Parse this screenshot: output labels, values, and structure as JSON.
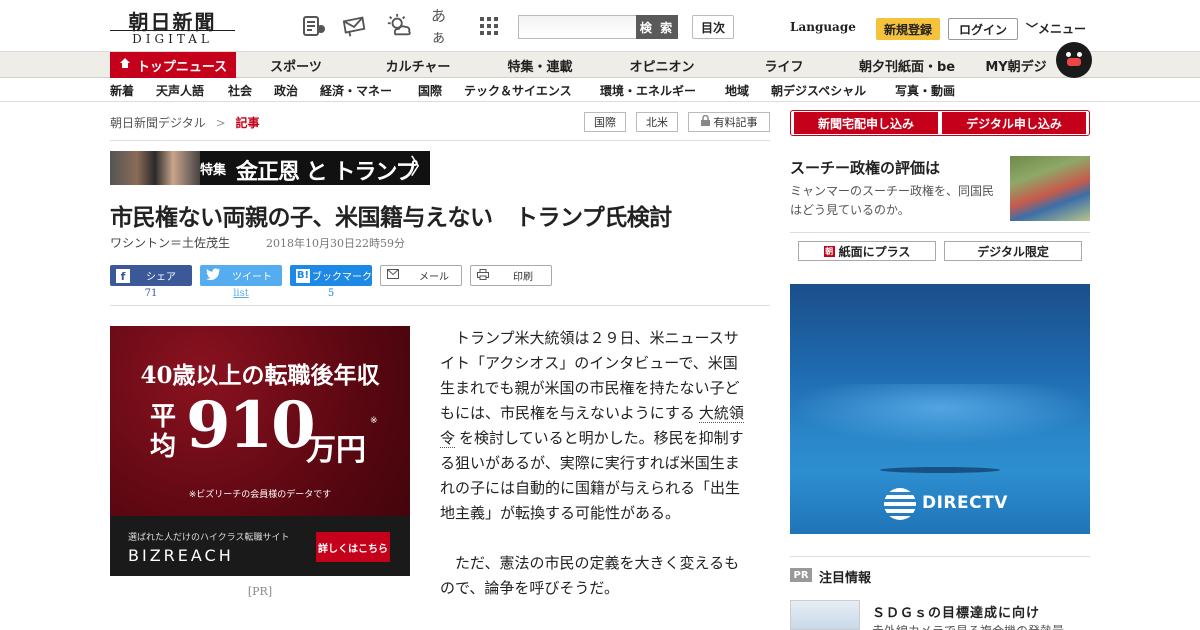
{
  "header": {
    "logo_main": "朝日新聞",
    "logo_sub": "DIGITAL",
    "search_button": "検 索",
    "toc_button": "目次",
    "language": "Language",
    "signup": "新規登録",
    "login": "ログイン",
    "menu": "メニュー",
    "icons": [
      "news-list-icon",
      "mail-sign-icon",
      "weather-icon",
      "font-size-icon",
      "grid-menu-icon"
    ],
    "font_glyph": "あぁ"
  },
  "nav1": {
    "items": [
      "トップニュース",
      "スポーツ",
      "カルチャー",
      "特集・連載",
      "オピニオン",
      "ライフ",
      "朝夕刊紙面・be",
      "MY朝デジ"
    ]
  },
  "nav2": {
    "items": [
      "新着",
      "天声人語",
      "社会",
      "政治",
      "経済・マネー",
      "国際",
      "テック＆サイエンス",
      "環境・エネルギー",
      "地域",
      "朝デジスペシャル",
      "写真・動画"
    ]
  },
  "breadcrumb": {
    "home": "朝日新聞デジタル",
    "separator": ">",
    "current": "記事"
  },
  "tags": [
    "国際",
    "北米",
    "有料記事"
  ],
  "feature": {
    "tag": "特集",
    "title": "金正恩 と トランプ",
    "arrow": "〉"
  },
  "article": {
    "headline": "市民権ない両親の子、米国籍与えない　トランプ氏検討",
    "byline": "ワシントン＝土佐茂生",
    "date": "2018年10月30日22時59分",
    "p1_a": "トランプ米大統領は２９日、米ニュースサイト「アクシオス」のインタビューで、米国生まれでも親が米国の市民権を持たない子どもには、市民権を与えないようにする",
    "p1_kw": "大統領令",
    "p1_b": "を検討していると明かした。移民を抑制する狙いがあるが、実際に実行すれば米国生まれの子には自動的に国籍が与えられる「出生地主義」が転換する可能性がある。",
    "p2": "ただ、憲法の市民の定義を大きく変えるもので、論争を呼びそうだ。"
  },
  "share": {
    "facebook": {
      "label": "シェア",
      "count": "71"
    },
    "twitter": {
      "label": "ツイート",
      "count": "list"
    },
    "hatena": {
      "label": "ブックマーク",
      "count": "5"
    },
    "mail": {
      "label": "メール"
    },
    "print": {
      "label": "印刷"
    }
  },
  "ad": {
    "line1": "40歳以上の転職後年収",
    "avg": "平均",
    "number": "910",
    "unit": "万円",
    "asterisk": "※",
    "note": "※ビズリーチの会員様のデータです",
    "tagline": "選ばれた人だけのハイクラス転職サイト",
    "brand": "BIZREACH",
    "cta": "詳しくはこちら",
    "pr": "[PR]"
  },
  "right": {
    "sub_newspaper": "新聞宅配申し込み",
    "sub_digital": "デジタル申し込み",
    "promo_title": "スーチー政権の評価は",
    "promo_desc": "ミャンマーのスーチー政権を、同国民はどう見ているのか。",
    "btn_paper": "紙面にプラス",
    "btn_digital": "デジタル限定",
    "directv": "DIRECTV",
    "pr_badge": "PR",
    "notice_title": "注目情報",
    "notice_head": "ＳＤＧｓの目標達成に向け",
    "notice_sub": "赤外線カメラで見る複合機の発熱量"
  },
  "colors": {
    "brand_red": "#c5001a",
    "signup_yellow": "#f5c23c"
  }
}
